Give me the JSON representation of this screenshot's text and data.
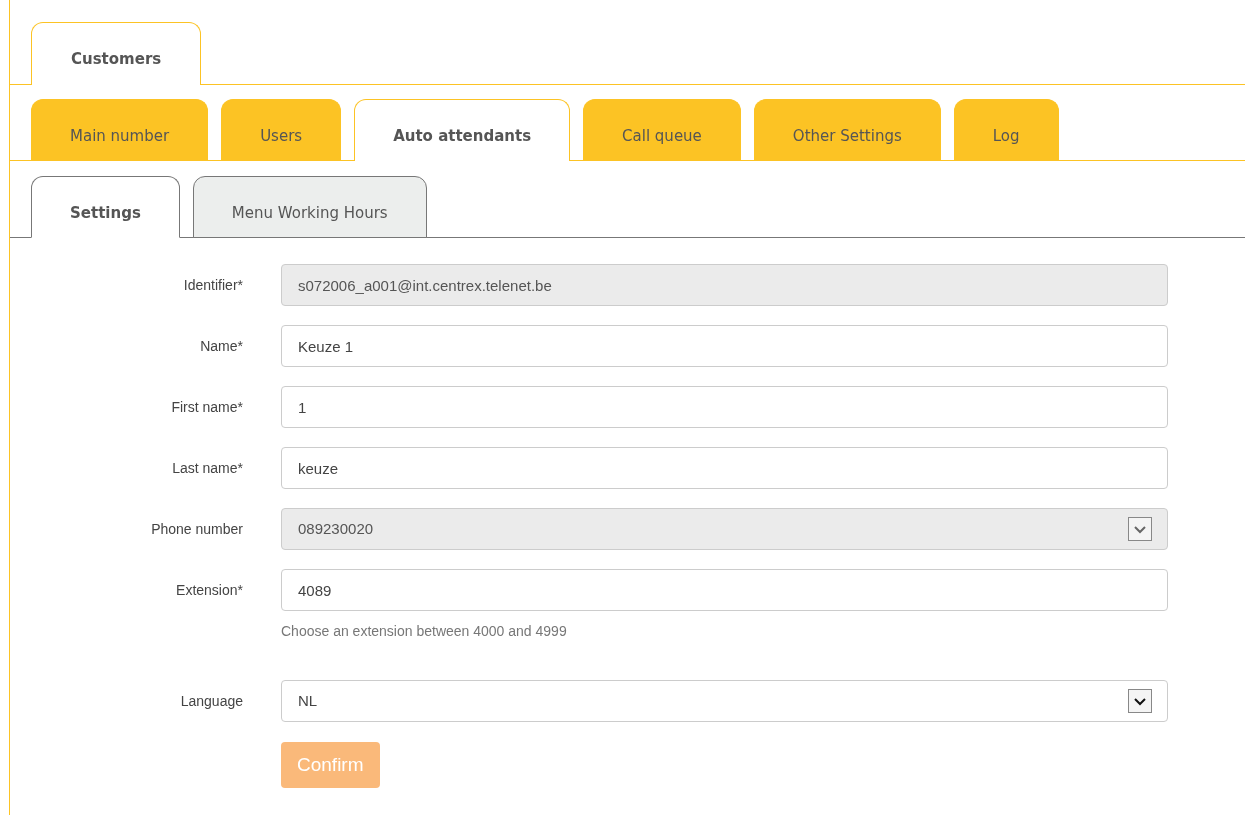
{
  "top_tabs": [
    {
      "label": "Customers",
      "selected": true
    }
  ],
  "section_tabs": [
    {
      "label": "Main number",
      "selected": false
    },
    {
      "label": "Users",
      "selected": false
    },
    {
      "label": "Auto attendants",
      "selected": true
    },
    {
      "label": "Call queue",
      "selected": false
    },
    {
      "label": "Other Settings",
      "selected": false
    },
    {
      "label": "Log",
      "selected": false
    }
  ],
  "sub_tabs": [
    {
      "label": "Settings",
      "selected": true
    },
    {
      "label": "Menu Working Hours",
      "selected": false
    }
  ],
  "form": {
    "fields": [
      {
        "kind": "text",
        "label": "Identifier*",
        "value": "s072006_a001@int.centrex.telenet.be",
        "disabled": true
      },
      {
        "kind": "text",
        "label": "Name*",
        "value": "Keuze 1",
        "disabled": false
      },
      {
        "kind": "text",
        "label": "First name*",
        "value": "1",
        "disabled": false
      },
      {
        "kind": "text",
        "label": "Last name*",
        "value": "keuze",
        "disabled": false
      },
      {
        "kind": "select",
        "label": "Phone number",
        "value": "089230020",
        "disabled": true
      },
      {
        "kind": "text",
        "label": "Extension*",
        "value": "4089",
        "disabled": false,
        "hint": "Choose an extension between 4000 and 4999"
      },
      {
        "kind": "select",
        "label": "Language",
        "value": "NL",
        "disabled": false
      }
    ],
    "confirm": {
      "label": "Confirm",
      "disabled": true
    }
  }
}
